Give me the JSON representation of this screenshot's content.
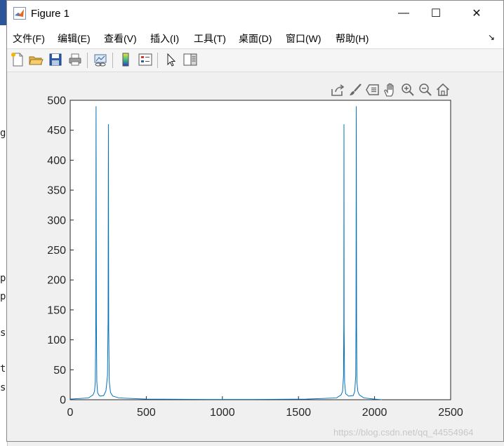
{
  "window": {
    "title": "Figure 1",
    "minimize_glyph": "—",
    "maximize_glyph": "☐",
    "close_glyph": "✕"
  },
  "menu": [
    {
      "label": "文件(F)"
    },
    {
      "label": "编辑(E)"
    },
    {
      "label": "查看(V)"
    },
    {
      "label": "插入(I)"
    },
    {
      "label": "工具(T)"
    },
    {
      "label": "桌面(D)"
    },
    {
      "label": "窗口(W)"
    },
    {
      "label": "帮助(H)"
    }
  ],
  "menu_dock_glyph": "↘",
  "toolbar": [
    {
      "icon": "new-figure-icon"
    },
    {
      "icon": "open-file-icon"
    },
    {
      "icon": "save-icon"
    },
    {
      "icon": "print-icon"
    },
    {
      "icon": "link-plot-icon"
    },
    {
      "icon": "colorbar-icon"
    },
    {
      "icon": "legend-icon"
    },
    {
      "icon": "edit-plot-pointer-icon"
    },
    {
      "icon": "property-inspector-icon"
    }
  ],
  "axes_toolbar": [
    {
      "icon": "export-icon"
    },
    {
      "icon": "brush-icon"
    },
    {
      "icon": "data-tips-icon"
    },
    {
      "icon": "pan-hand-icon"
    },
    {
      "icon": "zoom-in-icon"
    },
    {
      "icon": "zoom-out-icon"
    },
    {
      "icon": "home-icon"
    }
  ],
  "background_fragments": [
    "g",
    "p",
    "p",
    "s",
    "t",
    "s"
  ],
  "watermark": "https://blog.csdn.net/qq_44554964",
  "colors": {
    "line": "#0072bd",
    "window_bg": "#f0f0f0",
    "axes_bg": "#ffffff"
  },
  "chart_data": {
    "type": "line",
    "title": "",
    "xlabel": "",
    "ylabel": "",
    "xlim": [
      0,
      2500
    ],
    "ylim": [
      0,
      500
    ],
    "xticks": [
      0,
      500,
      1000,
      1500,
      2000,
      2500
    ],
    "yticks": [
      0,
      50,
      100,
      150,
      200,
      250,
      300,
      350,
      400,
      450,
      500
    ],
    "grid": false,
    "legend": "none",
    "series": [
      {
        "x": [
          0,
          120,
          150,
          160,
          165,
          168,
          170,
          172,
          175,
          180,
          190,
          200,
          220,
          235,
          245,
          249,
          251,
          253,
          257,
          265,
          280,
          320,
          500,
          900,
          1200,
          1550,
          1750,
          1780,
          1790,
          1796,
          1798,
          1799,
          1800,
          1803,
          1810,
          1830,
          1860,
          1870,
          1876,
          1878,
          1880,
          1882,
          1884,
          1890,
          1900,
          1930,
          2000,
          2048
        ],
        "y": [
          1,
          3,
          8,
          14,
          30,
          120,
          490,
          130,
          30,
          12,
          7,
          6,
          7,
          15,
          40,
          130,
          460,
          120,
          30,
          12,
          6,
          3,
          1,
          0.5,
          0.5,
          1,
          3,
          8,
          14,
          40,
          130,
          460,
          120,
          30,
          10,
          6,
          7,
          14,
          40,
          120,
          490,
          120,
          30,
          14,
          8,
          3,
          1,
          0
        ]
      }
    ]
  }
}
